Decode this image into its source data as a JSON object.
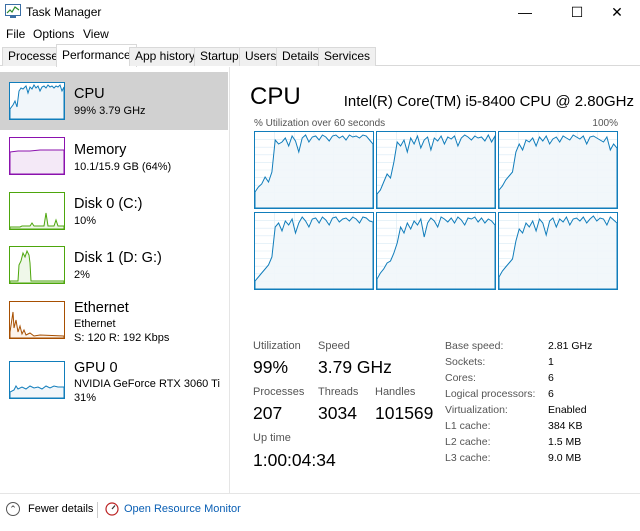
{
  "window": {
    "title": "Task Manager",
    "minimize": "—",
    "maximize": "☐",
    "close": "✕"
  },
  "menu": [
    "File",
    "Options",
    "View"
  ],
  "tabs": [
    {
      "label": "Processes",
      "active": false
    },
    {
      "label": "Performance",
      "active": true
    },
    {
      "label": "App history",
      "active": false
    },
    {
      "label": "Startup",
      "active": false
    },
    {
      "label": "Users",
      "active": false
    },
    {
      "label": "Details",
      "active": false
    },
    {
      "label": "Services",
      "active": false
    }
  ],
  "sidebar": {
    "items": [
      {
        "title": "CPU",
        "sub1": "99%  3.79 GHz",
        "sub2": "",
        "selected": true,
        "color": "#117dbb",
        "fill": "#f1f6fa"
      },
      {
        "title": "Memory",
        "sub1": "10.1/15.9 GB (64%)",
        "sub2": "",
        "selected": false,
        "color": "#8b12ae",
        "fill": "#f4e9f7"
      },
      {
        "title": "Disk 0 (C:)",
        "sub1": "10%",
        "sub2": "",
        "selected": false,
        "color": "#4da60c",
        "fill": "#eff7e9"
      },
      {
        "title": "Disk 1 (D: G:)",
        "sub1": "2%",
        "sub2": "",
        "selected": false,
        "color": "#4da60c",
        "fill": "#eff7e9"
      },
      {
        "title": "Ethernet",
        "sub1": "Ethernet",
        "sub2": "S: 120  R: 192 Kbps",
        "selected": false,
        "color": "#a74f01",
        "fill": "#fcf3eb"
      },
      {
        "title": "GPU 0",
        "sub1": "NVIDIA GeForce RTX 3060 Ti",
        "sub2": "31%",
        "selected": false,
        "color": "#117dbb",
        "fill": "#f1f6fa"
      }
    ]
  },
  "main": {
    "title": "CPU",
    "cpu_name": "Intel(R) Core(TM) i5-8400 CPU @ 2.80GHz",
    "util_label": "% Utilization over 60 seconds",
    "max_label": "100%",
    "stats": {
      "utilization_label": "Utilization",
      "utilization": "99%",
      "speed_label": "Speed",
      "speed": "3.79 GHz",
      "processes_label": "Processes",
      "processes": "207",
      "threads_label": "Threads",
      "threads": "3034",
      "handles_label": "Handles",
      "handles": "101569",
      "uptime_label": "Up time",
      "uptime": "1:00:04:34"
    },
    "specs": [
      {
        "label": "Base speed:",
        "value": "2.81 GHz"
      },
      {
        "label": "Sockets:",
        "value": "1"
      },
      {
        "label": "Cores:",
        "value": "6"
      },
      {
        "label": "Logical processors:",
        "value": "6"
      },
      {
        "label": "Virtualization:",
        "value": "Enabled"
      },
      {
        "label": "L1 cache:",
        "value": "384 KB"
      },
      {
        "label": "L2 cache:",
        "value": "1.5 MB"
      },
      {
        "label": "L3 cache:",
        "value": "9.0 MB"
      }
    ]
  },
  "footer": {
    "fewer_details": "Fewer details",
    "open_resmon": "Open Resource Monitor"
  },
  "colors": {
    "cpu": "#117dbb",
    "cpu_fill": "#f1f6fa",
    "grid": "#d9eaf4",
    "link": "#0a5fb4"
  }
}
